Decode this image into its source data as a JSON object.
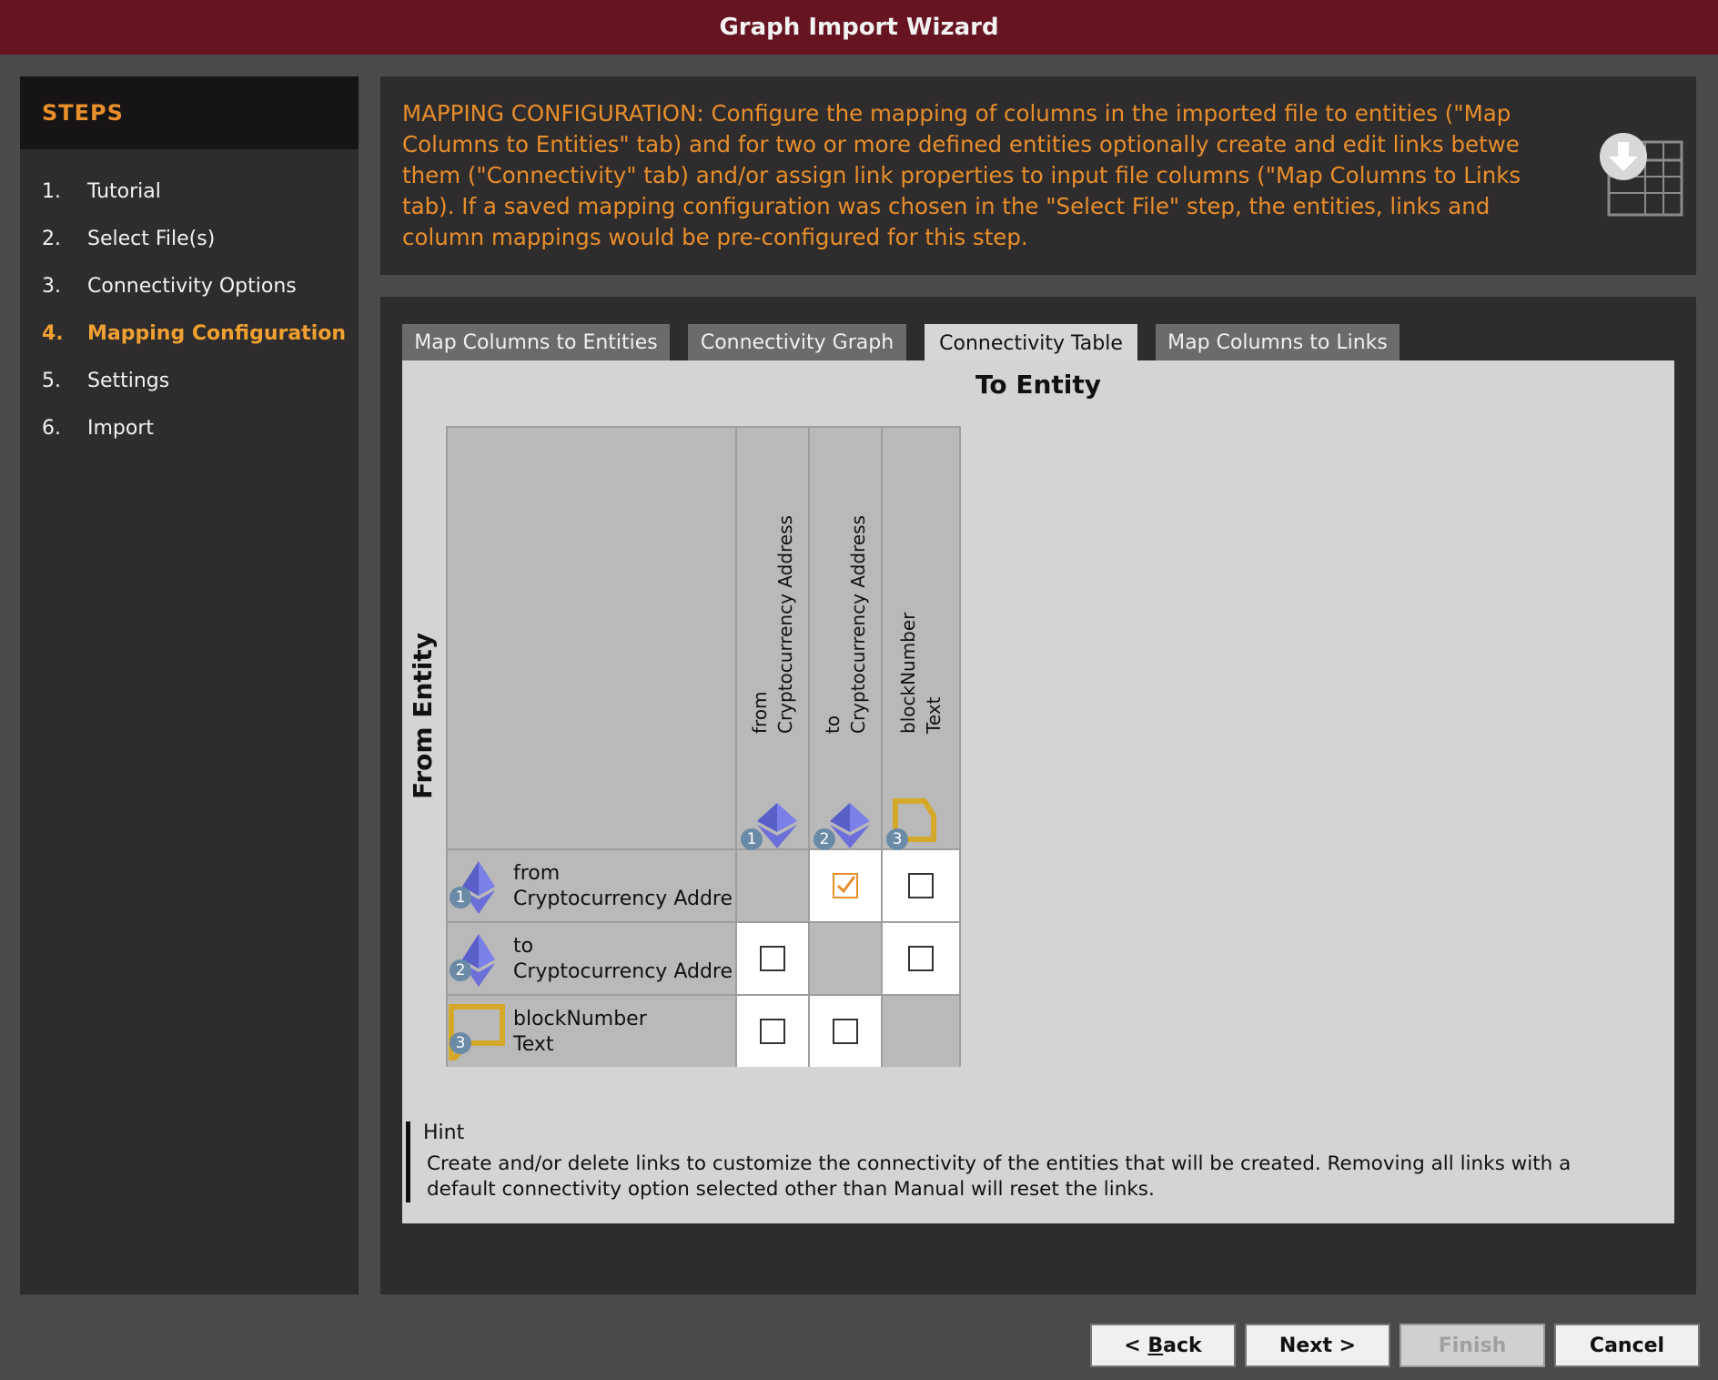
{
  "window": {
    "title": "Graph Import Wizard"
  },
  "steps": {
    "header": "STEPS",
    "items": [
      {
        "num": "1.",
        "label": "Tutorial"
      },
      {
        "num": "2.",
        "label": "Select File(s)"
      },
      {
        "num": "3.",
        "label": "Connectivity Options"
      },
      {
        "num": "4.",
        "label": "Mapping Configuration"
      },
      {
        "num": "5.",
        "label": "Settings"
      },
      {
        "num": "6.",
        "label": "Import"
      }
    ],
    "active_index": 3
  },
  "description": {
    "text": "MAPPING CONFIGURATION: Configure the mapping of columns in the imported file to entities (\"Map\nColumns to Entities\" tab) and for two or more defined entities optionally create and edit links betwe\nthem (\"Connectivity\" tab) and/or assign link properties to input file columns (\"Map Columns to Links\ntab). If a saved mapping configuration was chosen in the \"Select File\" step, the entities, links and\ncolumn mappings would be pre-configured for this step.",
    "icon": "table-import-icon"
  },
  "tabs": [
    {
      "label": "Map Columns to Entities",
      "active": false
    },
    {
      "label": "Connectivity Graph",
      "active": false
    },
    {
      "label": "Connectivity Table",
      "active": true
    },
    {
      "label": "Map Columns to Links",
      "active": false
    }
  ],
  "connectivity_table": {
    "to_label": "To Entity",
    "from_label": "From Entity",
    "columns": [
      {
        "badge": "1",
        "label": "from\nCryptocurrency Address",
        "icon": "ethereum-icon"
      },
      {
        "badge": "2",
        "label": "to\nCryptocurrency Address",
        "icon": "ethereum-icon"
      },
      {
        "badge": "3",
        "label": "blockNumber\nText",
        "icon": "text-speech-bubble-icon"
      }
    ],
    "rows": [
      {
        "badge": "1",
        "label": "from\nCryptocurrency Addre",
        "icon": "ethereum-icon",
        "cells": [
          null,
          true,
          false
        ]
      },
      {
        "badge": "2",
        "label": "to\nCryptocurrency Addre",
        "icon": "ethereum-icon",
        "cells": [
          false,
          null,
          false
        ]
      },
      {
        "badge": "3",
        "label": "blockNumber\nText",
        "icon": "text-speech-bubble-icon",
        "cells": [
          false,
          false,
          null
        ]
      }
    ]
  },
  "hint": {
    "title": "Hint",
    "text": "Create and/or delete links to customize the connectivity of the entities that will be created. Removing all links with a\ndefault connectivity option selected other than Manual will reset the links."
  },
  "buttons": {
    "back": {
      "prefix": "< ",
      "mnemonic": "B",
      "rest": "ack"
    },
    "next": "Next >",
    "finish": "Finish",
    "cancel": "Cancel"
  },
  "colors": {
    "title_bar": "#661520",
    "accent_orange": "#e88e2b",
    "panel_dark": "#2f2c2d",
    "badge_blue": "#6b8aa6",
    "ethereum_purple": "#6c6fd8",
    "text_icon_gold": "#d4a92a"
  }
}
